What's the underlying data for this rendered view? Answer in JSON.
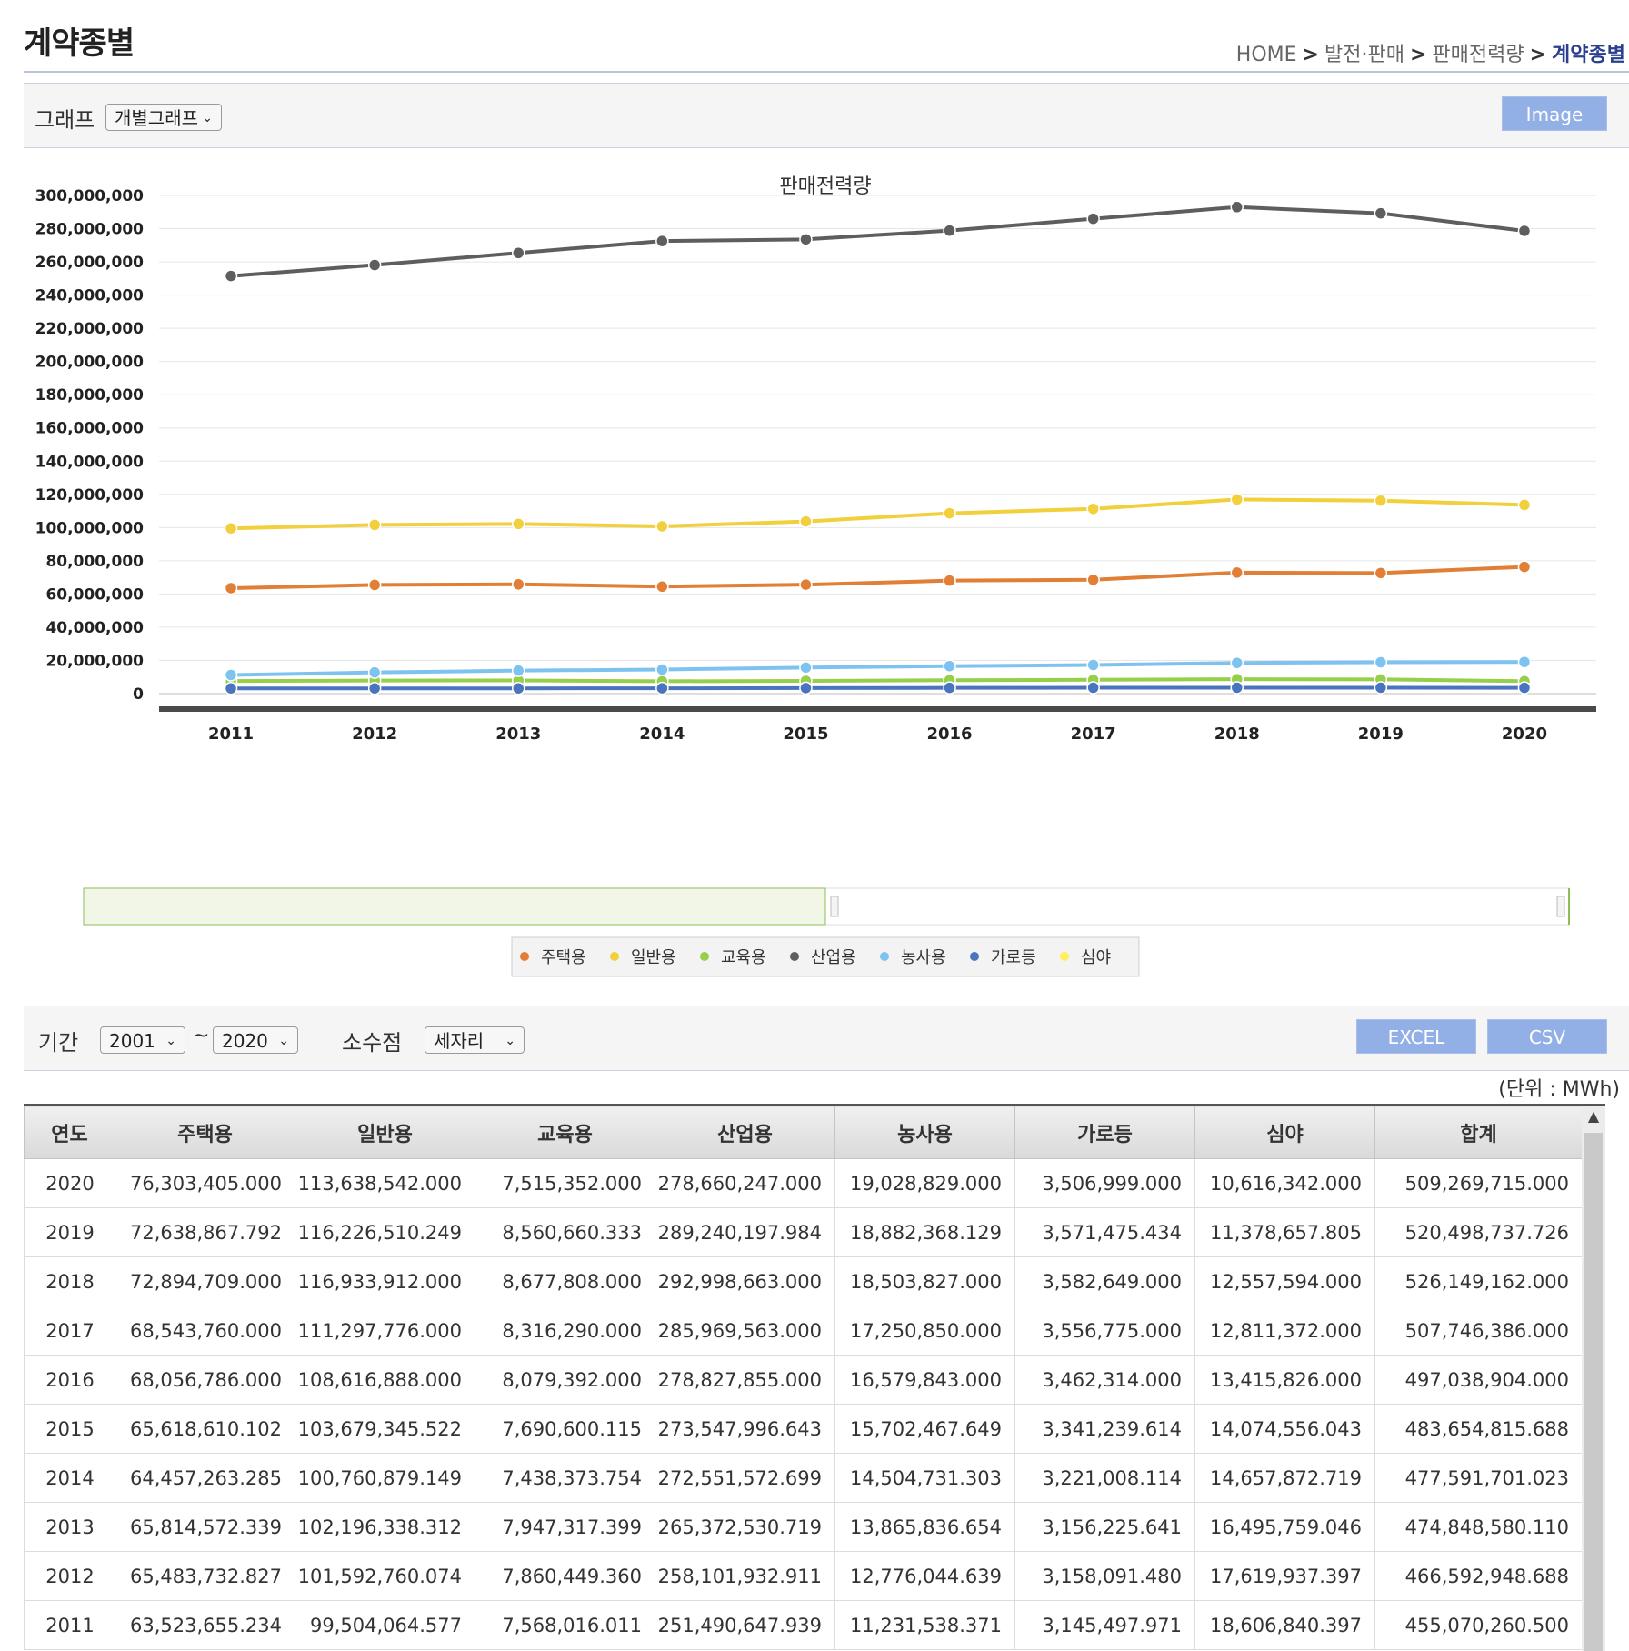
{
  "page": {
    "title": "계약종별",
    "breadcrumb": [
      "HOME",
      "발전·판매",
      "판매전력량",
      "계약종별"
    ]
  },
  "graph_toolbar": {
    "label": "그래프",
    "graph_type": "개별그래프",
    "image_button": "Image"
  },
  "filters": {
    "period_label": "기간",
    "from_year": "2001",
    "tilde": "~",
    "to_year": "2020",
    "decimal_label": "소수점",
    "decimal_value": "세자리",
    "excel_button": "EXCEL",
    "csv_button": "CSV"
  },
  "unit": "(단위 : MWh)",
  "chart_data": {
    "type": "line",
    "title": "판매전력량",
    "xlabel": "",
    "ylabel": "",
    "categories": [
      "2011",
      "2012",
      "2013",
      "2014",
      "2015",
      "2016",
      "2017",
      "2018",
      "2019",
      "2020"
    ],
    "ylim": [
      0,
      300000000
    ],
    "yticks": [
      "300,000,000",
      "280,000,000",
      "260,000,000",
      "240,000,000",
      "220,000,000",
      "200,000,000",
      "180,000,000",
      "160,000,000",
      "140,000,000",
      "120,000,000",
      "100,000,000",
      "80,000,000",
      "60,000,000",
      "40,000,000",
      "20,000,000",
      "0"
    ],
    "grid": true,
    "legend_position": "bottom",
    "series": [
      {
        "name": "주택용",
        "color": "#e07f35",
        "values": [
          63523655.234,
          65483732.827,
          65814572.339,
          64457263.285,
          65618610.102,
          68056786.0,
          68543760.0,
          72894709.0,
          72638867.792,
          76303405.0
        ]
      },
      {
        "name": "일반용",
        "color": "#f2cf3c",
        "values": [
          99504064.577,
          101592760.074,
          102196338.312,
          100760879.149,
          103679345.522,
          108616888.0,
          111297776.0,
          116933912.0,
          116226510.249,
          113638542.0
        ]
      },
      {
        "name": "교육용",
        "color": "#96cf4a",
        "values": [
          7568016.011,
          7860449.36,
          7947317.399,
          7438373.754,
          7690600.115,
          8079392.0,
          8316290.0,
          8677808.0,
          8560660.333,
          7515352.0
        ]
      },
      {
        "name": "산업용",
        "color": "#5e5e5e",
        "values": [
          251490647.939,
          258101932.911,
          265372530.719,
          272551572.699,
          273547996.643,
          278827855.0,
          285969563.0,
          292998663.0,
          289240197.984,
          278660247.0
        ]
      },
      {
        "name": "농사용",
        "color": "#7ec3f0",
        "values": [
          11231538.371,
          12776044.639,
          13865836.654,
          14504731.303,
          15702467.649,
          16579843.0,
          17250850.0,
          18503827.0,
          18882368.129,
          19028829.0
        ]
      },
      {
        "name": "가로등",
        "color": "#4a74bd",
        "values": [
          3145497.971,
          3158091.48,
          3156225.641,
          3221008.114,
          3341239.614,
          3462314.0,
          3556775.0,
          3582649.0,
          3571475.434,
          3506999.0
        ]
      },
      {
        "name": "심야",
        "color": "#ffef5a",
        "values": [
          18606840.397,
          17619937.397,
          16495759.046,
          14657872.719,
          14074556.043,
          13415826.0,
          12811372.0,
          12557594.0,
          11378657.805,
          10616342.0
        ],
        "hidden": true
      }
    ]
  },
  "table": {
    "headers": [
      "연도",
      "주택용",
      "일반용",
      "교육용",
      "산업용",
      "농사용",
      "가로등",
      "심야",
      "합계"
    ],
    "rows": [
      [
        "2020",
        "76,303,405.000",
        "113,638,542.000",
        "7,515,352.000",
        "278,660,247.000",
        "19,028,829.000",
        "3,506,999.000",
        "10,616,342.000",
        "509,269,715.000"
      ],
      [
        "2019",
        "72,638,867.792",
        "116,226,510.249",
        "8,560,660.333",
        "289,240,197.984",
        "18,882,368.129",
        "3,571,475.434",
        "11,378,657.805",
        "520,498,737.726"
      ],
      [
        "2018",
        "72,894,709.000",
        "116,933,912.000",
        "8,677,808.000",
        "292,998,663.000",
        "18,503,827.000",
        "3,582,649.000",
        "12,557,594.000",
        "526,149,162.000"
      ],
      [
        "2017",
        "68,543,760.000",
        "111,297,776.000",
        "8,316,290.000",
        "285,969,563.000",
        "17,250,850.000",
        "3,556,775.000",
        "12,811,372.000",
        "507,746,386.000"
      ],
      [
        "2016",
        "68,056,786.000",
        "108,616,888.000",
        "8,079,392.000",
        "278,827,855.000",
        "16,579,843.000",
        "3,462,314.000",
        "13,415,826.000",
        "497,038,904.000"
      ],
      [
        "2015",
        "65,618,610.102",
        "103,679,345.522",
        "7,690,600.115",
        "273,547,996.643",
        "15,702,467.649",
        "3,341,239.614",
        "14,074,556.043",
        "483,654,815.688"
      ],
      [
        "2014",
        "64,457,263.285",
        "100,760,879.149",
        "7,438,373.754",
        "272,551,572.699",
        "14,504,731.303",
        "3,221,008.114",
        "14,657,872.719",
        "477,591,701.023"
      ],
      [
        "2013",
        "65,814,572.339",
        "102,196,338.312",
        "7,947,317.399",
        "265,372,530.719",
        "13,865,836.654",
        "3,156,225.641",
        "16,495,759.046",
        "474,848,580.110"
      ],
      [
        "2012",
        "65,483,732.827",
        "101,592,760.074",
        "7,860,449.360",
        "258,101,932.911",
        "12,776,044.639",
        "3,158,091.480",
        "17,619,937.397",
        "466,592,948.688"
      ],
      [
        "2011",
        "63,523,655.234",
        "99,504,064.577",
        "7,568,016.011",
        "251,490,647.939",
        "11,231,538.371",
        "3,145,497.971",
        "18,606,840.397",
        "455,070,260.500"
      ]
    ]
  }
}
